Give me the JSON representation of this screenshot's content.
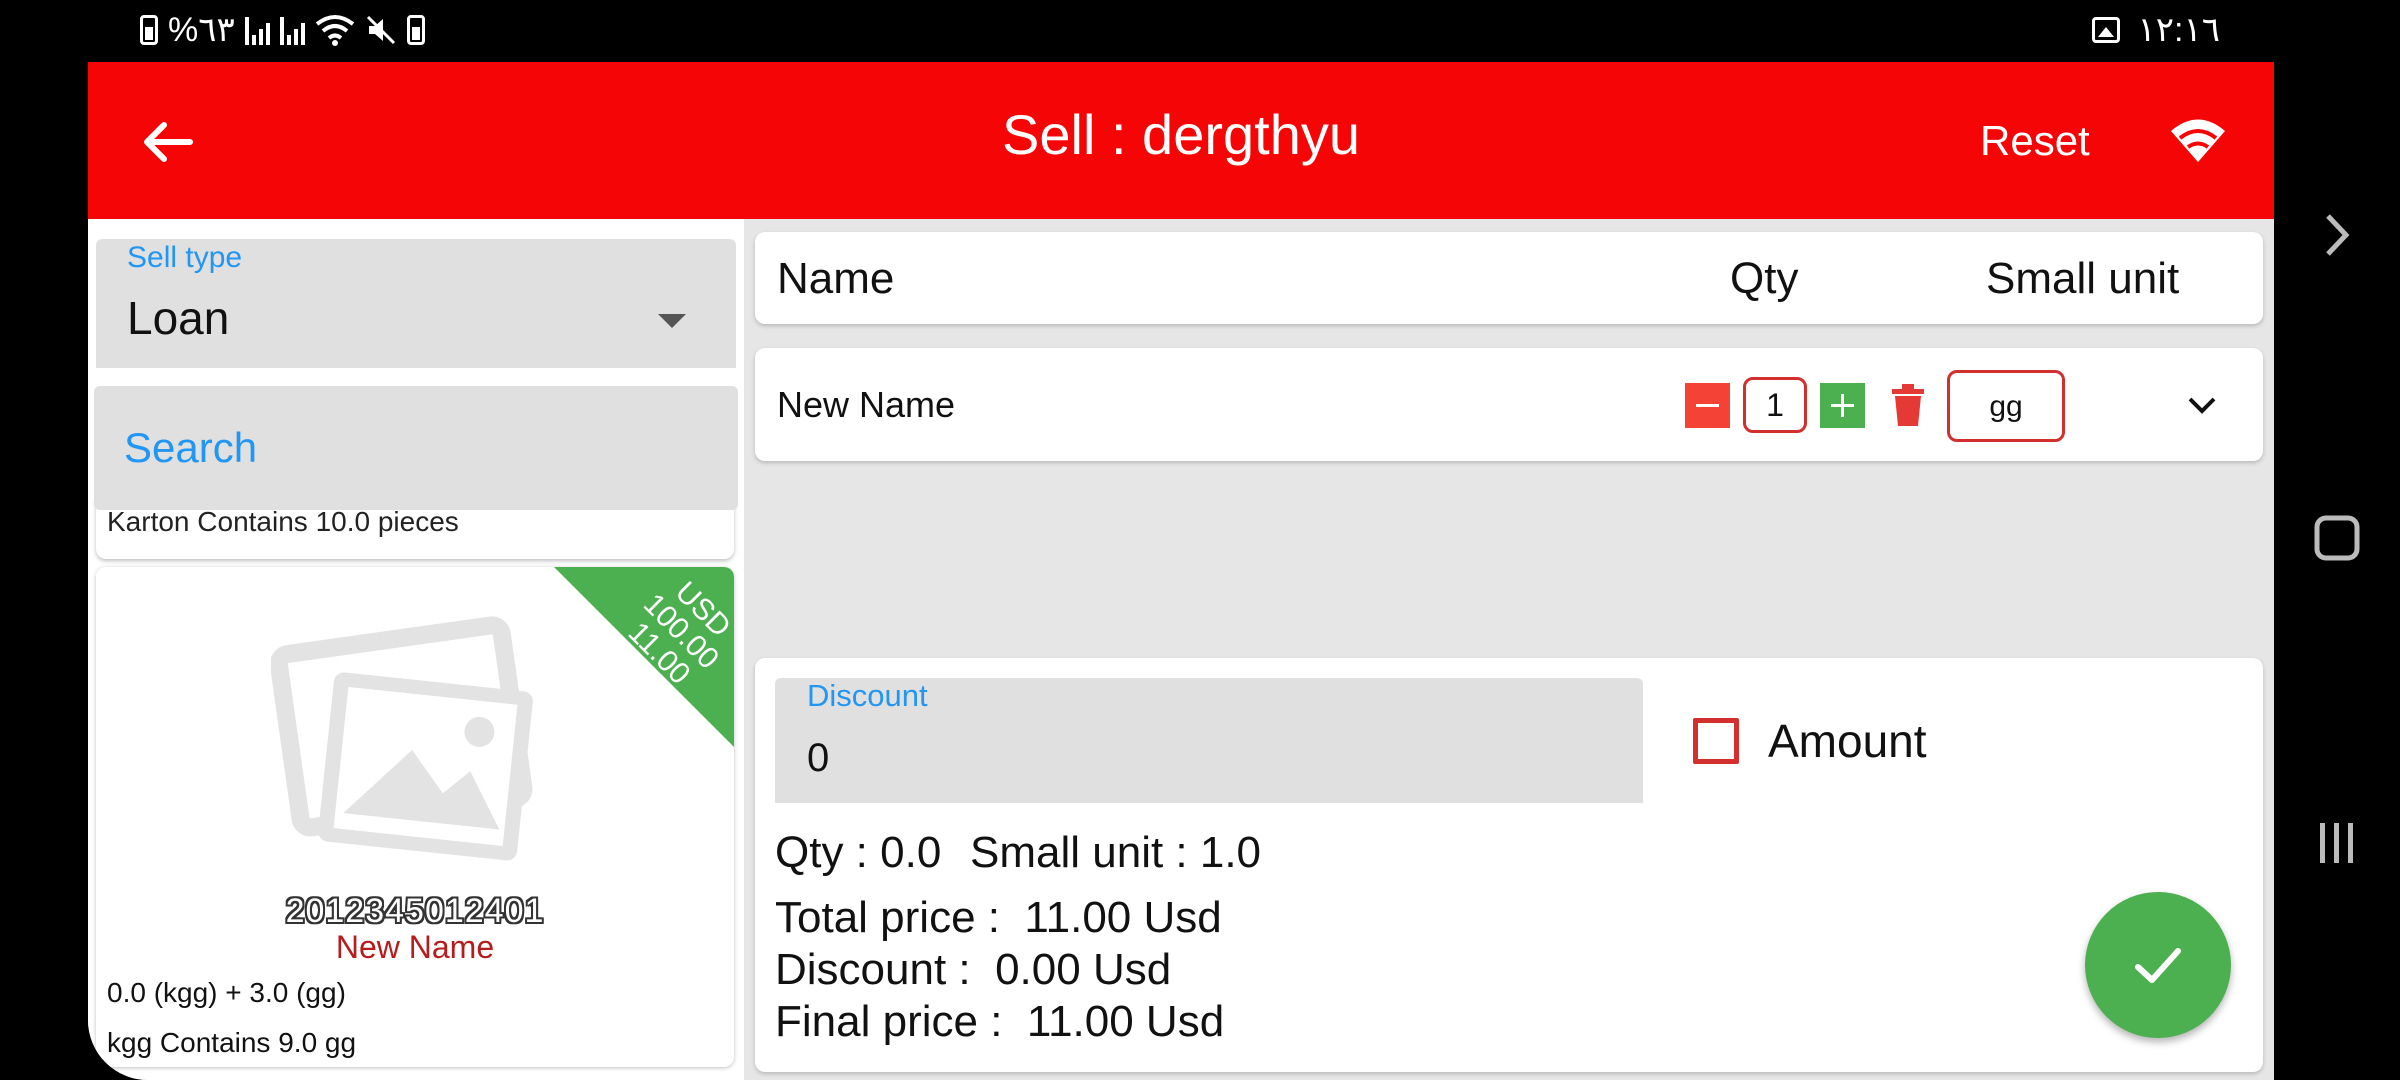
{
  "status_bar": {
    "battery_percent": "%٦٣",
    "time": "١٢:١٦",
    "left_icons": [
      "battery-charging-icon",
      "signal-icon",
      "signal-icon",
      "wifi-icon",
      "mute-icon",
      "battery-saver-icon"
    ],
    "right_icons": [
      "image-icon"
    ]
  },
  "app_bar": {
    "title": "Sell : dergthyu",
    "reset_label": "Reset",
    "back_icon": "arrow-left-icon",
    "connection_icon": "wifi-icon"
  },
  "left_panel": {
    "sell_type": {
      "label": "Sell type",
      "value": "Loan"
    },
    "search": {
      "placeholder": "Search"
    },
    "partial_card_text": "Karton Contains 10.0 pieces",
    "product_card": {
      "ribbon_lines": [
        "USD",
        "100.00",
        "11.00"
      ],
      "barcode": "2012345012401",
      "name": "New Name",
      "stock_line": "0.0 (kgg) +   3.0 (gg)",
      "conversion_line": "kgg Contains 9.0 gg"
    }
  },
  "cart": {
    "headers": {
      "name": "Name",
      "qty": "Qty",
      "unit": "Small unit"
    },
    "items": [
      {
        "name": "New Name",
        "qty": "1",
        "unit": "gg"
      }
    ]
  },
  "summary": {
    "discount_label": "Discount",
    "discount_value": "0",
    "amount_label": "Amount",
    "amount_checked": false,
    "qty_line": "Qty : 0.0",
    "small_unit_line": "Small unit : 1.0",
    "total_price_line": "Total price :  11.00 Usd",
    "discount_line": "Discount :  0.00 Usd",
    "final_price_line": "Final price :  11.00 Usd"
  },
  "colors": {
    "app_bar": "#f50505",
    "accent_blue": "#2196f3",
    "green": "#4caf50",
    "red_outline": "#d32f2f"
  }
}
